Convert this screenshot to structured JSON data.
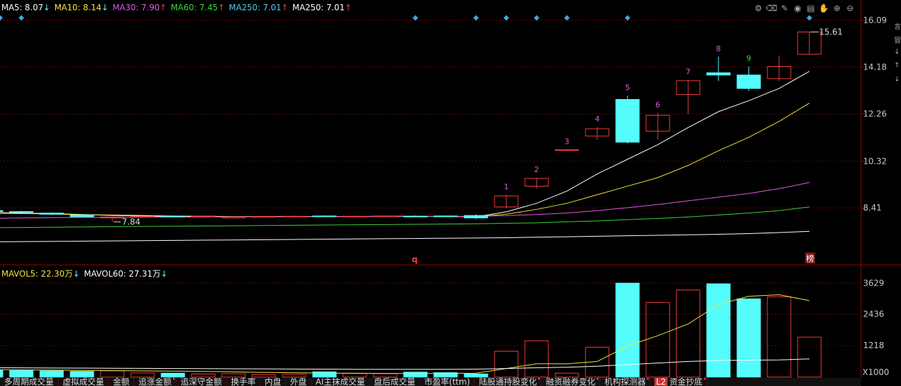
{
  "ma_legend": [
    {
      "label": "MA5: 8.07",
      "arrow": "↓",
      "color": "#ffffff"
    },
    {
      "label": "MA10: 8.14",
      "arrow": "↓",
      "color": "#f5e33c"
    },
    {
      "label": "MA30: 7.90",
      "arrow": "↑",
      "color": "#e05ce0"
    },
    {
      "label": "MA60: 7.45",
      "arrow": "↑",
      "color": "#39d339"
    },
    {
      "label": "MA250: 7.01",
      "arrow": "↑",
      "color": "#58c8e8"
    },
    {
      "label": "MA250: 7.01",
      "arrow": "↑",
      "color": "#ffffff"
    }
  ],
  "vol_legend": [
    {
      "label": "MAVOL5: 22.30万",
      "arrow": "↓",
      "color": "#f5e33c"
    },
    {
      "label": "MAVOL60: 27.31万",
      "arrow": "↓",
      "color": "#ffffff"
    }
  ],
  "colors": {
    "up": "#f03c3c",
    "down": "#54fcfc",
    "grid": "#7a0000",
    "axis_text": "#c8c8c8",
    "marker": "#3fa8e0"
  },
  "toolbar_icons": [
    "settings-icon",
    "eraser-icon",
    "edit-icon",
    "eye-icon",
    "print-icon",
    "hand-icon",
    "zoom-in-icon",
    "zoom-out-icon"
  ],
  "chart_data": {
    "type": "candlestick",
    "y_ticks": [
      "16.09",
      "14.18",
      "12.26",
      "10.32",
      "8.41"
    ],
    "ylim": [
      6.5,
      16.3
    ],
    "vol_ticks": [
      "3629",
      "2436",
      "1218"
    ],
    "vol_unit_label": "X1000",
    "vol_lim": [
      0,
      3800
    ],
    "max_label": "15.61",
    "min_label": "7.84",
    "markers_bottom": [
      "q",
      "榜"
    ],
    "candles": [
      {
        "o": 8.2,
        "c": 8.25,
        "h": 8.26,
        "l": 8.18,
        "v": 420
      },
      {
        "o": 8.25,
        "c": 8.22,
        "h": 8.28,
        "l": 8.2,
        "v": 300
      },
      {
        "o": 8.22,
        "c": 8.15,
        "h": 8.24,
        "l": 8.12,
        "v": 250
      },
      {
        "o": 8.2,
        "c": 8.24,
        "h": 8.3,
        "l": 8.19,
        "v": 380
      },
      {
        "o": 8.3,
        "c": 8.26,
        "h": 8.32,
        "l": 8.25,
        "v": 260
      },
      {
        "o": 8.26,
        "c": 8.24,
        "h": 8.3,
        "l": 8.22,
        "v": 250
      },
      {
        "o": 8.2,
        "c": 8.15,
        "h": 8.22,
        "l": 8.12,
        "v": 240
      },
      {
        "o": 8.12,
        "c": 8.05,
        "h": 8.14,
        "l": 8.02,
        "v": 220
      },
      {
        "o": 8.0,
        "c": 8.04,
        "h": 8.06,
        "l": 7.84,
        "v": 240
      },
      {
        "o": 8.04,
        "c": 8.06,
        "h": 8.08,
        "l": 8.02,
        "v": 160
      },
      {
        "o": 8.07,
        "c": 8.06,
        "h": 8.08,
        "l": 8.04,
        "v": 150
      },
      {
        "o": 8.06,
        "c": 8.08,
        "h": 8.09,
        "l": 8.04,
        "v": 120
      },
      {
        "o": 8.0,
        "c": 8.04,
        "h": 8.06,
        "l": 7.98,
        "v": 130
      },
      {
        "o": 8.04,
        "c": 8.06,
        "h": 8.08,
        "l": 8.02,
        "v": 90
      },
      {
        "o": 8.06,
        "c": 8.07,
        "h": 8.1,
        "l": 8.04,
        "v": 110
      },
      {
        "o": 8.08,
        "c": 8.06,
        "h": 8.1,
        "l": 8.04,
        "v": 200
      },
      {
        "o": 8.05,
        "c": 8.07,
        "h": 8.1,
        "l": 8.03,
        "v": 140
      },
      {
        "o": 8.07,
        "c": 8.08,
        "h": 8.1,
        "l": 8.05,
        "v": 130
      },
      {
        "o": 8.07,
        "c": 8.06,
        "h": 8.1,
        "l": 8.04,
        "v": 190
      },
      {
        "o": 8.08,
        "c": 8.05,
        "h": 8.1,
        "l": 8.04,
        "v": 170
      },
      {
        "o": 8.1,
        "c": 8.0,
        "h": 8.15,
        "l": 7.95,
        "v": 120
      },
      {
        "o": 8.45,
        "c": 8.9,
        "h": 8.95,
        "l": 8.4,
        "v": 1000
      },
      {
        "o": 9.3,
        "c": 9.62,
        "h": 9.65,
        "l": 9.2,
        "v": 1400
      },
      {
        "o": 10.77,
        "c": 10.79,
        "h": 10.8,
        "l": 10.76,
        "v": 150
      },
      {
        "o": 11.35,
        "c": 11.65,
        "h": 11.72,
        "l": 11.2,
        "v": 1150
      },
      {
        "o": 12.85,
        "c": 11.1,
        "h": 13.0,
        "l": 11.05,
        "v": 3629
      },
      {
        "o": 11.55,
        "c": 12.2,
        "h": 12.3,
        "l": 11.2,
        "v": 2880
      },
      {
        "o": 13.05,
        "c": 13.62,
        "h": 13.65,
        "l": 12.25,
        "v": 3360
      },
      {
        "o": 13.94,
        "c": 13.85,
        "h": 14.6,
        "l": 13.6,
        "v": 3600
      },
      {
        "o": 13.85,
        "c": 13.3,
        "h": 14.2,
        "l": 13.2,
        "v": 3020
      },
      {
        "o": 13.7,
        "c": 14.2,
        "h": 14.65,
        "l": 13.6,
        "v": 3100
      },
      {
        "o": 14.7,
        "c": 15.61,
        "h": 15.61,
        "l": 14.7,
        "v": 1540
      }
    ],
    "numbered_labels": [
      {
        "index": 21,
        "text": "1"
      },
      {
        "index": 22,
        "text": "2"
      },
      {
        "index": 23,
        "text": "3"
      },
      {
        "index": 24,
        "text": "4"
      },
      {
        "index": 25,
        "text": "5"
      },
      {
        "index": 26,
        "text": "6"
      },
      {
        "index": 27,
        "text": "7"
      },
      {
        "index": 28,
        "text": "8"
      },
      {
        "index": 29,
        "text": "9"
      }
    ],
    "diamond_markers": [
      7,
      8,
      11,
      18,
      20,
      21,
      22,
      23,
      26
    ],
    "ma_lines": [
      {
        "name": "MA5",
        "color": "#ffffff",
        "values": [
          8.2,
          8.2,
          8.18,
          8.2,
          8.22,
          8.2,
          8.18,
          8.14,
          8.1,
          8.08,
          8.06,
          8.05,
          8.05,
          8.05,
          8.06,
          8.06,
          8.06,
          8.07,
          8.07,
          8.06,
          8.05,
          8.25,
          8.6,
          9.1,
          9.8,
          10.4,
          11.0,
          11.7,
          12.35,
          12.8,
          13.3,
          14.0
        ]
      },
      {
        "name": "MA10",
        "color": "#f5e33c",
        "values": [
          8.22,
          8.22,
          8.2,
          8.2,
          8.2,
          8.18,
          8.16,
          8.13,
          8.12,
          8.1,
          8.08,
          8.07,
          8.06,
          8.06,
          8.06,
          8.06,
          8.06,
          8.06,
          8.06,
          8.06,
          8.06,
          8.15,
          8.35,
          8.6,
          8.95,
          9.3,
          9.65,
          10.15,
          10.75,
          11.3,
          11.95,
          12.7
        ]
      },
      {
        "name": "MA30",
        "color": "#e05ce0",
        "values": [
          7.9,
          7.92,
          7.94,
          7.96,
          7.98,
          8.0,
          8.01,
          8.02,
          8.02,
          8.03,
          8.04,
          8.04,
          8.05,
          8.05,
          8.05,
          8.06,
          8.06,
          8.06,
          8.06,
          8.06,
          8.07,
          8.09,
          8.14,
          8.2,
          8.3,
          8.42,
          8.55,
          8.7,
          8.85,
          9.0,
          9.2,
          9.45
        ]
      },
      {
        "name": "MA60",
        "color": "#39d339",
        "values": [
          7.55,
          7.56,
          7.57,
          7.58,
          7.6,
          7.61,
          7.62,
          7.63,
          7.64,
          7.65,
          7.66,
          7.67,
          7.68,
          7.69,
          7.7,
          7.71,
          7.72,
          7.73,
          7.74,
          7.75,
          7.76,
          7.78,
          7.8,
          7.84,
          7.88,
          7.93,
          7.98,
          8.04,
          8.12,
          8.2,
          8.3,
          8.45
        ]
      },
      {
        "name": "MA250",
        "color": "#ffffff",
        "values": [
          6.98,
          6.99,
          7.0,
          7.01,
          7.02,
          7.03,
          7.04,
          7.05,
          7.06,
          7.07,
          7.08,
          7.09,
          7.1,
          7.11,
          7.12,
          7.13,
          7.14,
          7.15,
          7.16,
          7.17,
          7.18,
          7.19,
          7.21,
          7.23,
          7.25,
          7.27,
          7.29,
          7.31,
          7.33,
          7.36,
          7.4,
          7.45
        ]
      }
    ],
    "vol_ma_lines": [
      {
        "name": "MAVOL5",
        "color": "#f5e33c",
        "values": [
          320,
          310,
          300,
          300,
          290,
          280,
          270,
          260,
          250,
          240,
          230,
          220,
          200,
          180,
          170,
          150,
          150,
          140,
          140,
          140,
          150,
          330,
          510,
          510,
          600,
          1200,
          1600,
          2050,
          2800,
          3120,
          3180,
          2950
        ]
      },
      {
        "name": "MAVOL60",
        "color": "#ffffff",
        "values": [
          380,
          375,
          370,
          365,
          360,
          355,
          350,
          345,
          340,
          335,
          330,
          325,
          320,
          315,
          310,
          305,
          300,
          300,
          300,
          300,
          305,
          330,
          360,
          380,
          420,
          480,
          540,
          600,
          640,
          650,
          660,
          700
        ]
      }
    ]
  },
  "bottom_tabs": [
    {
      "label": "多周期成交量",
      "dot": false
    },
    {
      "label": "虚拟成交量",
      "dot": false
    },
    {
      "label": "金额",
      "dot": false
    },
    {
      "label": "追涨金额",
      "dot": true
    },
    {
      "label": "追深守金额",
      "dot": false
    },
    {
      "label": "换手率",
      "dot": false
    },
    {
      "label": "内盘",
      "dot": false
    },
    {
      "label": "外盘",
      "dot": false
    },
    {
      "label": "AI主抹成交量",
      "dot": false
    },
    {
      "label": "盘后成交量",
      "dot": false
    },
    {
      "label": "市盈率(ttm)",
      "dot": false
    },
    {
      "label": "陆股通持股变化",
      "dot": true
    },
    {
      "label": "融资融券变化",
      "dot": true
    },
    {
      "label": "机构探测器",
      "dot": true
    },
    {
      "label": "资金抄底",
      "dot": true,
      "badge": "L2"
    }
  ],
  "right_scroll_glyphs": [
    "言",
    "冒",
    "↓",
    "↑",
    "↓"
  ]
}
